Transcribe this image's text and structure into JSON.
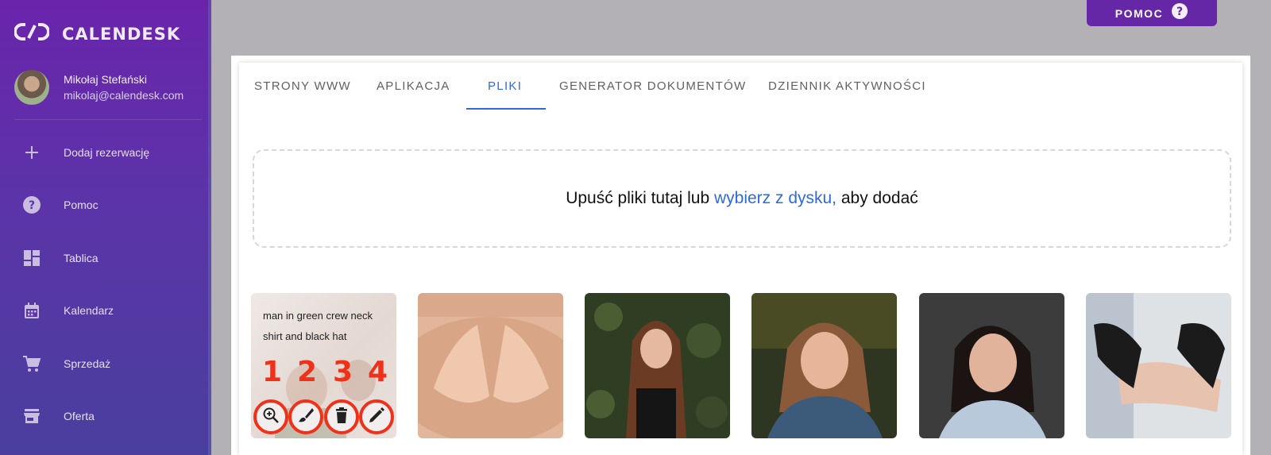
{
  "app": {
    "brand": "CALENDESK"
  },
  "user": {
    "name": "Mikołaj Stefański",
    "email": "mikolaj@calendesk.com"
  },
  "sidebar": {
    "items": [
      {
        "label": "Dodaj rezerwację",
        "icon": "plus-icon"
      },
      {
        "label": "Pomoc",
        "icon": "help-circle-icon"
      },
      {
        "label": "Tablica",
        "icon": "dashboard-icon"
      },
      {
        "label": "Kalendarz",
        "icon": "calendar-icon"
      },
      {
        "label": "Sprzedaż",
        "icon": "cart-icon"
      },
      {
        "label": "Oferta",
        "icon": "store-icon"
      }
    ]
  },
  "header": {
    "help_label": "POMOC"
  },
  "tabs": [
    {
      "label": "STRONY WWW",
      "active": false
    },
    {
      "label": "APLIKACJA",
      "active": false
    },
    {
      "label": "PLIKI",
      "active": true
    },
    {
      "label": "GENERATOR DOKUMENTÓW",
      "active": false
    },
    {
      "label": "DZIENNIK AKTYWNOŚCI",
      "active": false
    }
  ],
  "dropzone": {
    "text_before": "Upuść pliki tutaj lub",
    "link": "wybierz z dysku,",
    "text_after": "aby dodać"
  },
  "files": {
    "hover_caption": "man in green crew neck shirt and black hat",
    "action_numbers": [
      "1",
      "2",
      "3",
      "4"
    ],
    "actions": [
      "zoom-in-icon",
      "brush-icon",
      "trash-icon",
      "pencil-icon"
    ]
  },
  "colors": {
    "accent": "#2e6ad8",
    "brand": "#6527a6",
    "highlight": "#f0311a"
  }
}
